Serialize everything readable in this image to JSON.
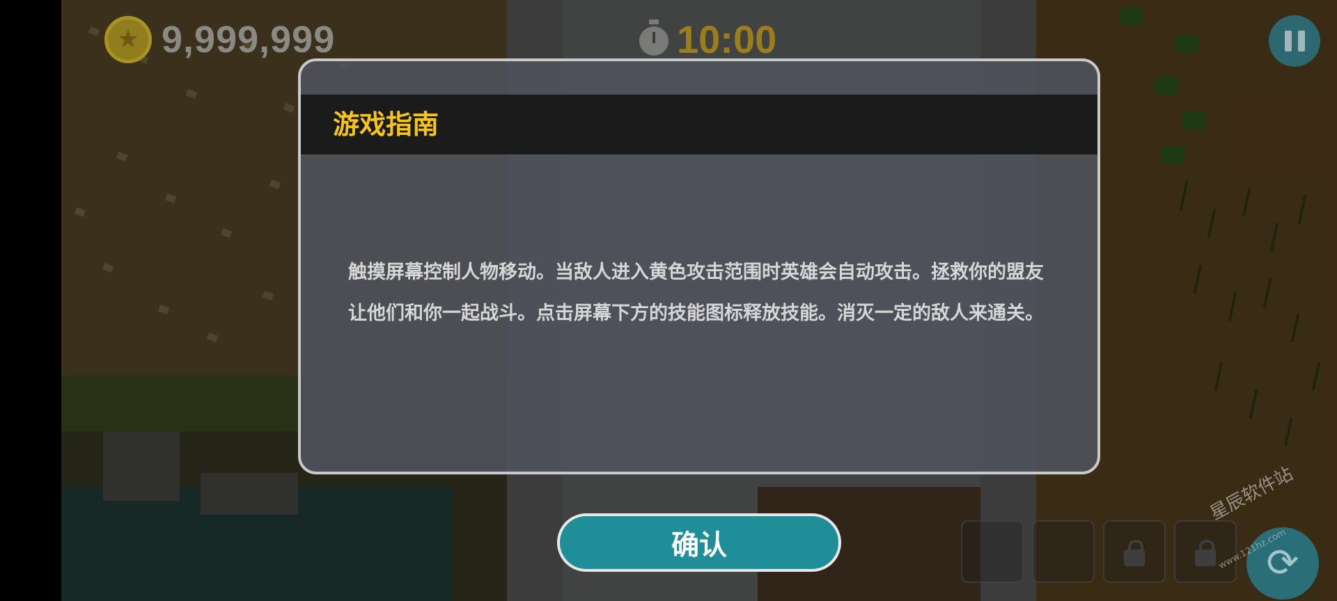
{
  "hud": {
    "coins": "9,999,999",
    "coin_icon": "star-coin-icon",
    "timer": "10:00",
    "timer_icon": "stopwatch-icon",
    "pause_icon": "pause-icon"
  },
  "dialog": {
    "title": "游戏指南",
    "body": "触摸屏幕控制人物移动。当敌人进入黄色攻击范围时英雄会自动攻击。拯救你的盟友让他们和你一起战斗。点击屏幕下方的技能图标释放技能。消灭一定的敌人来通关。",
    "confirm_label": "确认"
  },
  "skills": {
    "locked_icon": "lock-icon",
    "refresh_icon": "refresh-icon"
  },
  "watermark": {
    "text": "星辰软件站",
    "sub": "www.121hz.com"
  },
  "colors": {
    "title_accent": "#f5c51a",
    "button_teal": "#1f8e98",
    "timer_gold": "#9a7e1c"
  }
}
